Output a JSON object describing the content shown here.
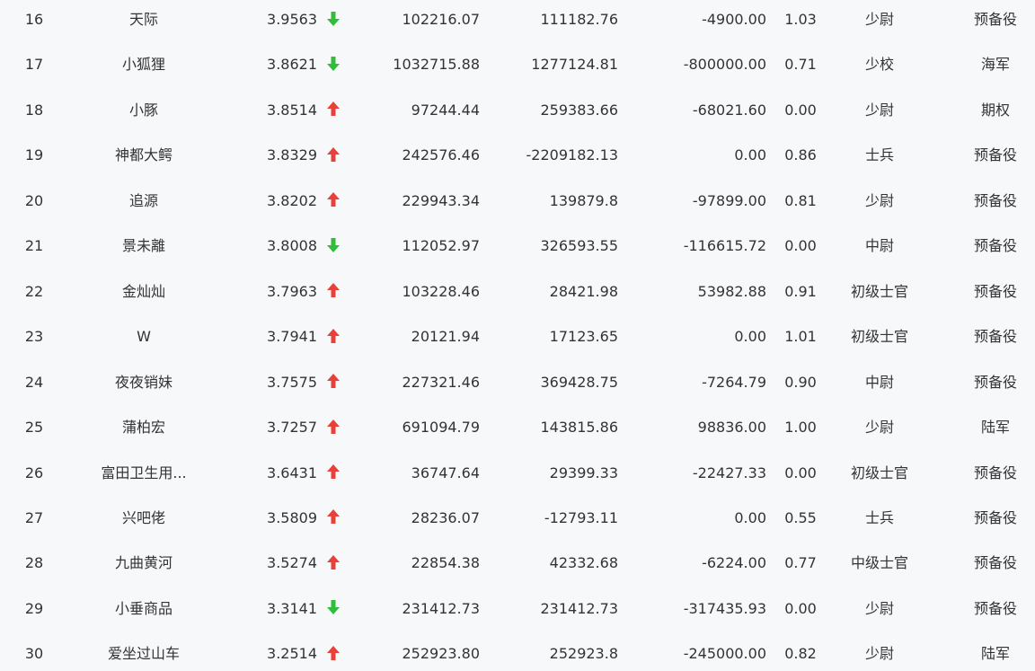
{
  "colors": {
    "background": "#f7f8fa",
    "text": "#333333",
    "up_arrow": "#e8413a",
    "down_arrow": "#2fbd3a"
  },
  "rows": [
    {
      "rank": "16",
      "name": "天际",
      "score": "3.9563",
      "trend": "down",
      "v1": "102216.07",
      "v2": "111182.76",
      "v3": "-4900.00",
      "ratio": "1.03",
      "title": "少尉",
      "branch": "预备役"
    },
    {
      "rank": "17",
      "name": "小狐狸",
      "score": "3.8621",
      "trend": "down",
      "v1": "1032715.88",
      "v2": "1277124.81",
      "v3": "-800000.00",
      "ratio": "0.71",
      "title": "少校",
      "branch": "海军"
    },
    {
      "rank": "18",
      "name": "小豚",
      "score": "3.8514",
      "trend": "up",
      "v1": "97244.44",
      "v2": "259383.66",
      "v3": "-68021.60",
      "ratio": "0.00",
      "title": "少尉",
      "branch": "期权"
    },
    {
      "rank": "19",
      "name": "神都大鳄",
      "score": "3.8329",
      "trend": "up",
      "v1": "242576.46",
      "v2": "-2209182.13",
      "v3": "0.00",
      "ratio": "0.86",
      "title": "士兵",
      "branch": "预备役"
    },
    {
      "rank": "20",
      "name": "追源",
      "score": "3.8202",
      "trend": "up",
      "v1": "229943.34",
      "v2": "139879.8",
      "v3": "-97899.00",
      "ratio": "0.81",
      "title": "少尉",
      "branch": "预备役"
    },
    {
      "rank": "21",
      "name": "景未離",
      "score": "3.8008",
      "trend": "down",
      "v1": "112052.97",
      "v2": "326593.55",
      "v3": "-116615.72",
      "ratio": "0.00",
      "title": "中尉",
      "branch": "预备役"
    },
    {
      "rank": "22",
      "name": "金灿灿",
      "score": "3.7963",
      "trend": "up",
      "v1": "103228.46",
      "v2": "28421.98",
      "v3": "53982.88",
      "ratio": "0.91",
      "title": "初级士官",
      "branch": "预备役"
    },
    {
      "rank": "23",
      "name": "W",
      "score": "3.7941",
      "trend": "up",
      "v1": "20121.94",
      "v2": "17123.65",
      "v3": "0.00",
      "ratio": "1.01",
      "title": "初级士官",
      "branch": "预备役"
    },
    {
      "rank": "24",
      "name": "夜夜销妹",
      "score": "3.7575",
      "trend": "up",
      "v1": "227321.46",
      "v2": "369428.75",
      "v3": "-7264.79",
      "ratio": "0.90",
      "title": "中尉",
      "branch": "预备役"
    },
    {
      "rank": "25",
      "name": "蒲柏宏",
      "score": "3.7257",
      "trend": "up",
      "v1": "691094.79",
      "v2": "143815.86",
      "v3": "98836.00",
      "ratio": "1.00",
      "title": "少尉",
      "branch": "陆军"
    },
    {
      "rank": "26",
      "name": "富田卫生用...",
      "score": "3.6431",
      "trend": "up",
      "v1": "36747.64",
      "v2": "29399.33",
      "v3": "-22427.33",
      "ratio": "0.00",
      "title": "初级士官",
      "branch": "预备役"
    },
    {
      "rank": "27",
      "name": "兴吧佬",
      "score": "3.5809",
      "trend": "up",
      "v1": "28236.07",
      "v2": "-12793.11",
      "v3": "0.00",
      "ratio": "0.55",
      "title": "士兵",
      "branch": "预备役"
    },
    {
      "rank": "28",
      "name": "九曲黄河",
      "score": "3.5274",
      "trend": "up",
      "v1": "22854.38",
      "v2": "42332.68",
      "v3": "-6224.00",
      "ratio": "0.77",
      "title": "中级士官",
      "branch": "预备役"
    },
    {
      "rank": "29",
      "name": "小垂商品",
      "score": "3.3141",
      "trend": "down",
      "v1": "231412.73",
      "v2": "231412.73",
      "v3": "-317435.93",
      "ratio": "0.00",
      "title": "少尉",
      "branch": "预备役"
    },
    {
      "rank": "30",
      "name": "爱坐过山车",
      "score": "3.2514",
      "trend": "up",
      "v1": "252923.80",
      "v2": "252923.8",
      "v3": "-245000.00",
      "ratio": "0.82",
      "title": "少尉",
      "branch": "陆军"
    }
  ]
}
